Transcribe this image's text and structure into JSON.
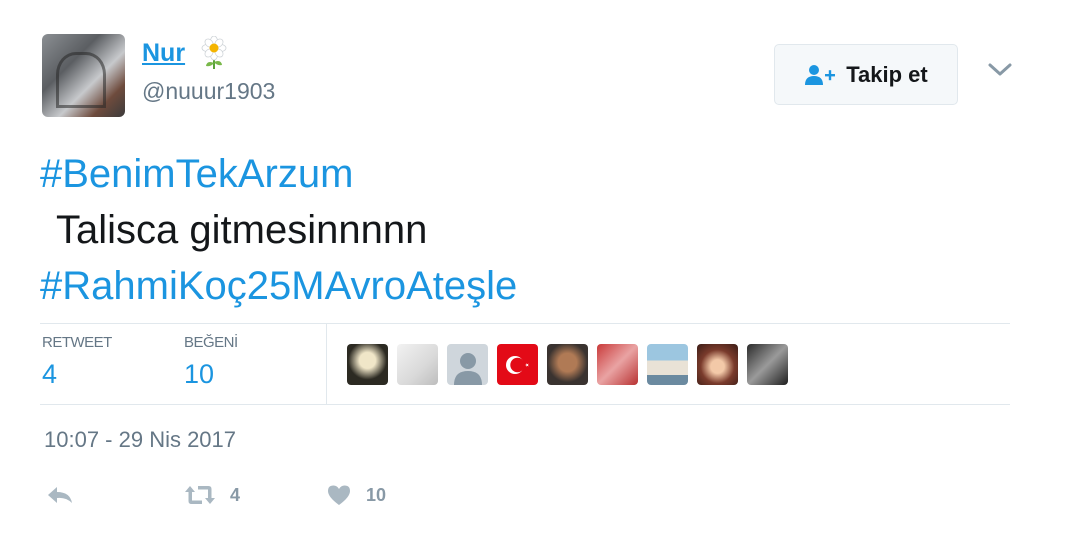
{
  "user": {
    "name": "Nur",
    "handle": "@nuuur1903"
  },
  "follow_button": {
    "label": "Takip et"
  },
  "tweet": {
    "hashtag1": "#BenimTekArzum",
    "text": "Talisca gitmesinnnnn",
    "hashtag2": "#RahmiKoç25MAvroAteşle"
  },
  "stats": {
    "retweet_label": "RETWEET",
    "retweet_count": "4",
    "like_label": "BEĞENİ",
    "like_count": "10"
  },
  "timestamp": "10:07 - 29 Nis 2017",
  "actions": {
    "retweet_count": "4",
    "like_count": "10"
  },
  "colors": {
    "link": "#1b95e0",
    "muted": "#657786",
    "border": "#e1e8ed"
  }
}
